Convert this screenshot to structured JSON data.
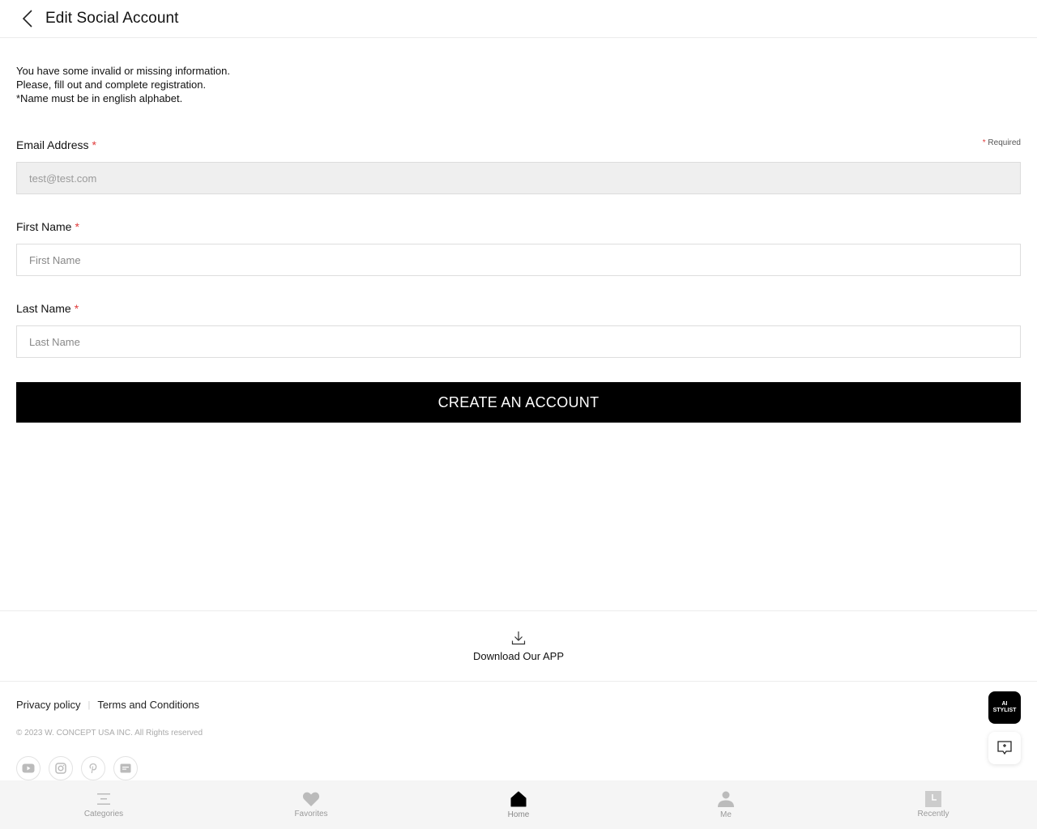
{
  "header": {
    "title": "Edit Social Account",
    "back_icon": "chevron-left-icon"
  },
  "notice": {
    "line1": "You have some invalid or missing information.",
    "line2": "Please, fill out and complete registration.",
    "line3": "*Name must be in english alphabet."
  },
  "form": {
    "required_note": "Required",
    "required_star": "*",
    "email": {
      "label": "Email Address",
      "value": "test@test.com",
      "disabled": true
    },
    "first_name": {
      "label": "First Name",
      "placeholder": "First Name",
      "value": ""
    },
    "last_name": {
      "label": "Last Name",
      "placeholder": "Last Name",
      "value": ""
    },
    "submit_label": "CREATE AN ACCOUNT"
  },
  "app_download": {
    "label": "Download Our APP",
    "icon": "download-icon"
  },
  "footer": {
    "privacy": "Privacy policy",
    "separator": "|",
    "terms": "Terms and Conditions",
    "copyright": "© 2023 W. CONCEPT USA INC. All Rights reserved",
    "socials": [
      "youtube-icon",
      "instagram-icon",
      "pinterest-icon",
      "blog-icon"
    ]
  },
  "floating": {
    "ai_line1": "AI",
    "ai_line2": "STYLIST",
    "chat_icon": "chat-icon"
  },
  "bottom_nav": {
    "items": [
      {
        "label": "Categories",
        "icon": "menu-icon"
      },
      {
        "label": "Favorites",
        "icon": "heart-icon"
      },
      {
        "label": "Home",
        "icon": "home-icon"
      },
      {
        "label": "Me",
        "icon": "user-icon"
      },
      {
        "label": "Recently",
        "icon": "clock-icon"
      }
    ]
  },
  "colors": {
    "accent": "#000000",
    "required": "#e03a3a",
    "disabled_bg": "#efefef",
    "nav_bg": "#f5f5f5"
  }
}
